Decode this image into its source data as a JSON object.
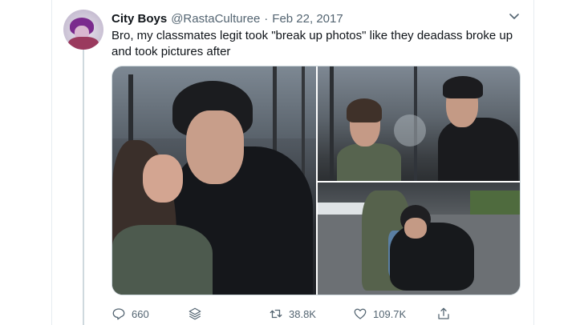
{
  "tweet": {
    "display_name": "City Boys",
    "handle": "@RastaCulturee",
    "separator": "·",
    "date": "Feb 22, 2017",
    "text": "Bro, my classmates legit took \"break up photos\" like they deadass broke up and took pictures after",
    "media": [
      "photo-1",
      "photo-2",
      "photo-3"
    ]
  },
  "actions": {
    "reply_count": "660",
    "retweet_count": "38.8K",
    "like_count": "109.7K"
  },
  "icons": {
    "reply": "reply-icon",
    "stack": "stack-icon",
    "retweet": "retweet-icon",
    "like": "heart-icon",
    "share": "share-icon",
    "caret": "chevron-down-icon"
  },
  "colors": {
    "text": "#0f1419",
    "muted": "#536471",
    "border": "#cfd9de"
  }
}
